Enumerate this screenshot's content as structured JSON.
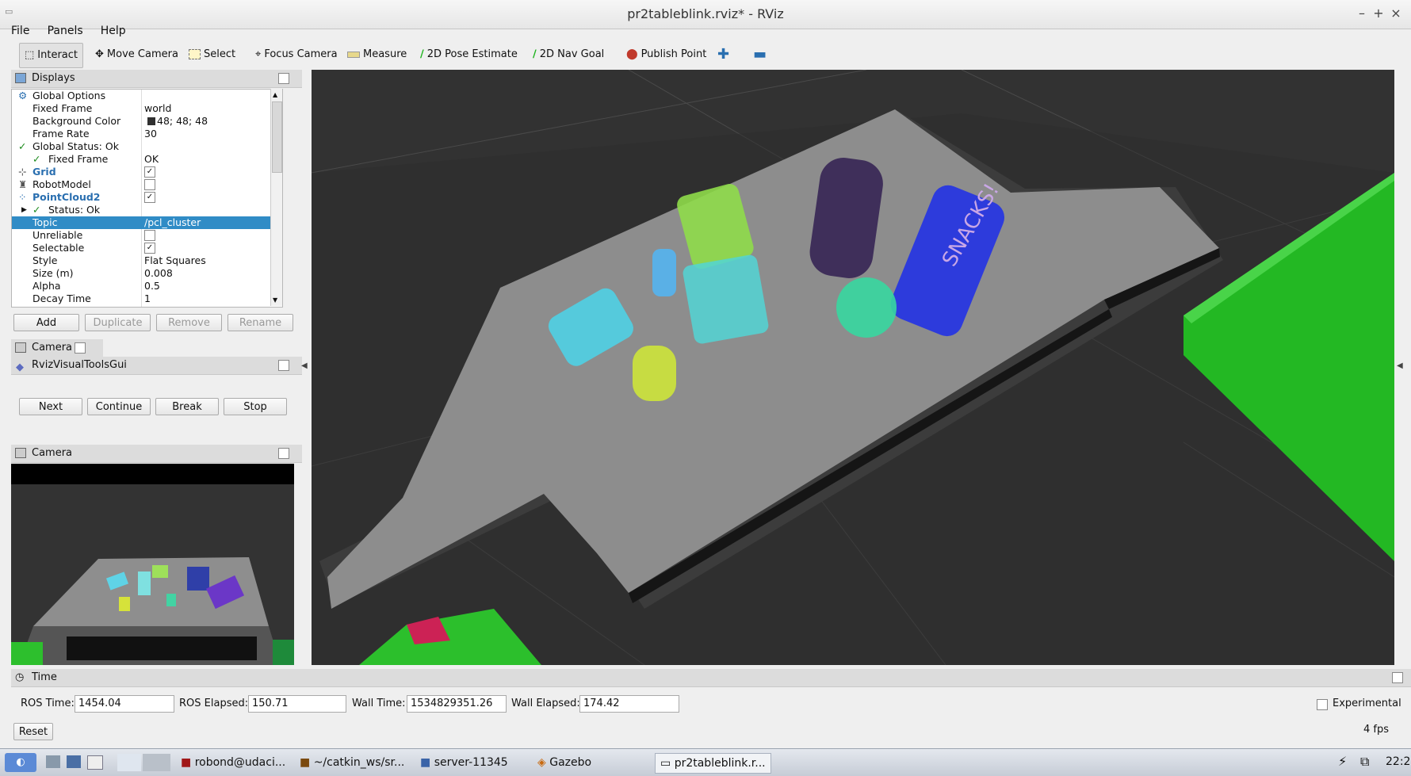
{
  "window": {
    "title": "pr2tableblink.rviz* - RViz"
  },
  "menu": [
    "File",
    "Panels",
    "Help"
  ],
  "toolbar": [
    {
      "label": "Interact",
      "icon": "interact-icon"
    },
    {
      "label": "Move Camera",
      "icon": "move-camera-icon"
    },
    {
      "label": "Select",
      "icon": "select-icon"
    },
    {
      "label": "Focus Camera",
      "icon": "focus-camera-icon"
    },
    {
      "label": "Measure",
      "icon": "measure-icon"
    },
    {
      "label": "2D Pose Estimate",
      "icon": "pose-arrow-icon"
    },
    {
      "label": "2D Nav Goal",
      "icon": "nav-goal-arrow-icon"
    },
    {
      "label": "Publish Point",
      "icon": "map-pin-icon"
    }
  ],
  "displays": {
    "title": "Displays",
    "rows": [
      {
        "key": "Global Options",
        "value": ""
      },
      {
        "key": "Fixed Frame",
        "value": "world"
      },
      {
        "key": "Background Color",
        "value": "48; 48; 48"
      },
      {
        "key": "Frame Rate",
        "value": "30"
      },
      {
        "key": "Global Status: Ok",
        "value": ""
      },
      {
        "key": "Fixed Frame",
        "value": "OK"
      },
      {
        "key": "Grid",
        "value": ""
      },
      {
        "key": "RobotModel",
        "value": ""
      },
      {
        "key": "PointCloud2",
        "value": ""
      },
      {
        "key": "Status: Ok",
        "value": ""
      },
      {
        "key": "Topic",
        "value": "/pcl_cluster"
      },
      {
        "key": "Unreliable",
        "value": ""
      },
      {
        "key": "Selectable",
        "value": ""
      },
      {
        "key": "Style",
        "value": "Flat Squares"
      },
      {
        "key": "Size (m)",
        "value": "0.008"
      },
      {
        "key": "Alpha",
        "value": "0.5"
      },
      {
        "key": "Decay Time",
        "value": "1"
      }
    ],
    "buttons": [
      "Add",
      "Duplicate",
      "Remove",
      "Rename"
    ]
  },
  "camera_tab": "Camera",
  "rviz_tools": {
    "title": "RvizVisualToolsGui",
    "buttons": [
      "Next",
      "Continue",
      "Break",
      "Stop"
    ]
  },
  "camera_panel": {
    "title": "Camera"
  },
  "viewport": {
    "label_snacks": "SNACKS!"
  },
  "time": {
    "title": "Time",
    "ros_time_label": "ROS Time:",
    "ros_time": "1454.04",
    "ros_elapsed_label": "ROS Elapsed:",
    "ros_elapsed": "150.71",
    "wall_time_label": "Wall Time:",
    "wall_time": "1534829351.26",
    "wall_elapsed_label": "Wall Elapsed:",
    "wall_elapsed": "174.42",
    "experimental": "Experimental",
    "reset": "Reset",
    "fps": "4 fps"
  },
  "taskbar": {
    "items": [
      "robond@udaci...",
      "~/catkin_ws/sr...",
      "server-11345",
      "Gazebo",
      "pr2tableblink.r..."
    ],
    "clock": "22:2"
  }
}
